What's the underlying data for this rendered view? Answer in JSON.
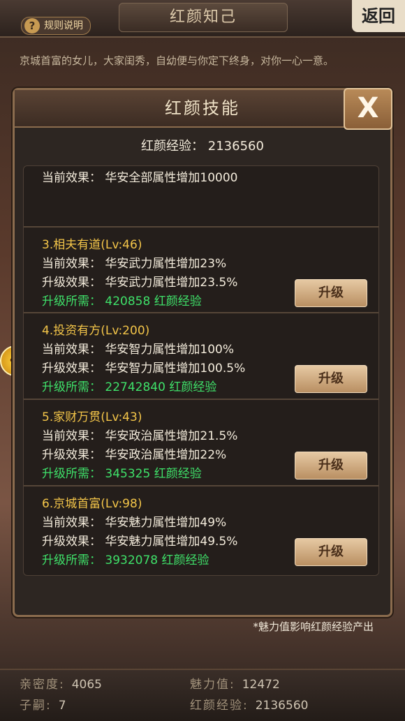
{
  "header": {
    "title": "红颜知己",
    "rules_label": "规则说明",
    "back_label": "返回"
  },
  "intro_text": "京城首富的女儿，大家闺秀，自幼便与你定下终身，对你一心一意。",
  "modal": {
    "title": "红颜技能",
    "close_label": "X",
    "exp_label": "红颜经验：",
    "exp_value": "2136560",
    "first_card_effect": "当前效果：  华安全部属性增加10000",
    "skills": [
      {
        "name": "3.相夫有道(Lv:46)",
        "current": "当前效果：  华安武力属性增加23%",
        "next": "升级效果：  华安武力属性增加23.5%",
        "cost": "升级所需：  420858  红颜经验",
        "button": "升级"
      },
      {
        "name": "4.投资有方(Lv:200)",
        "current": "当前效果：  华安智力属性增加100%",
        "next": "升级效果：  华安智力属性增加100.5%",
        "cost": "升级所需：  22742840  红颜经验",
        "button": "升级"
      },
      {
        "name": "5.家财万贯(Lv:43)",
        "current": "当前效果：  华安政治属性增加21.5%",
        "next": "升级效果：  华安政治属性增加22%",
        "cost": "升级所需：  345325  红颜经验",
        "button": "升级"
      },
      {
        "name": "6.京城首富(Lv:98)",
        "current": "当前效果：  华安魅力属性增加49%",
        "next": "升级效果：  华安魅力属性增加49.5%",
        "cost": "升级所需：  3932078  红颜经验",
        "button": "升级"
      }
    ],
    "footnote": "*魅力值影响红颜经验产出"
  },
  "stats": {
    "intimacy_label": "亲密度:",
    "intimacy_value": "4065",
    "charm_label": "魅力值:",
    "charm_value": "12472",
    "heirs_label": "子嗣:",
    "heirs_value": "7",
    "exp_label": "红颜经验:",
    "exp_value": "2136560"
  },
  "icons": {
    "rules": "question-icon",
    "close": "close-icon",
    "side_badge": "bird-icon"
  }
}
